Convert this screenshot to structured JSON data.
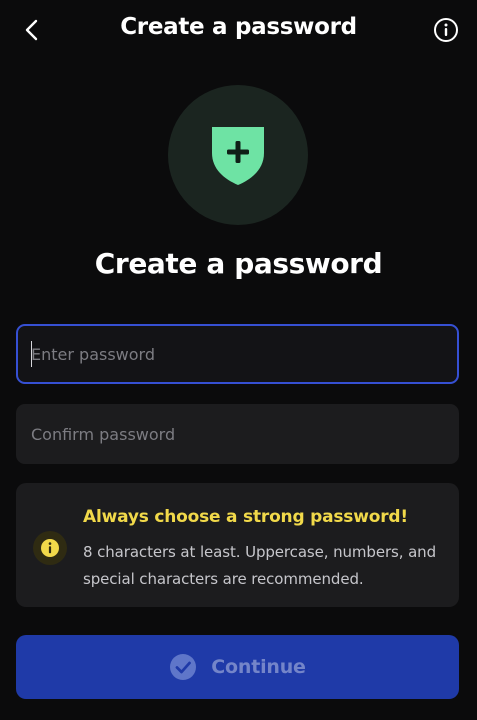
{
  "header": {
    "title": "Create a password",
    "back_icon": "chevron-left-icon",
    "info_icon": "info-icon"
  },
  "hero": {
    "icon": "shield-plus-icon",
    "title": "Create a password",
    "colors": {
      "shield": "#6ee3a4",
      "circle": "#1b2520"
    }
  },
  "form": {
    "password_placeholder": "Enter password",
    "password_value": "",
    "confirm_placeholder": "Confirm password",
    "confirm_value": ""
  },
  "notice": {
    "icon": "info-icon",
    "title": "Always choose a strong password!",
    "body": "8 characters at least. Uppercase, numbers, and special characters are recommended.",
    "colors": {
      "title": "#f1d94a"
    }
  },
  "continue_button": {
    "label": "Continue",
    "icon": "check-circle-icon",
    "colors": {
      "background": "#1f3aa8"
    }
  }
}
